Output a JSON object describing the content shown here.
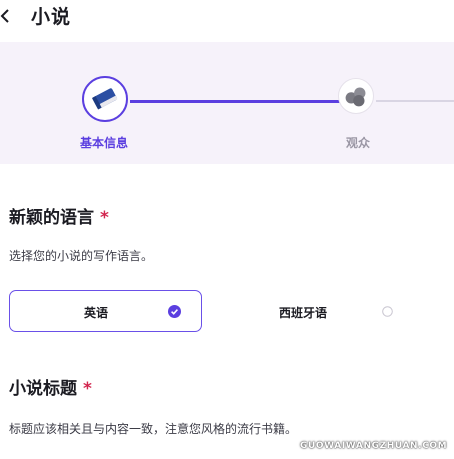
{
  "header": {
    "title": "小说"
  },
  "stepper": {
    "steps": [
      {
        "label": "基本信息",
        "icon": "book-icon",
        "state": "active"
      },
      {
        "label": "观众",
        "icon": "audience-icon",
        "state": "inactive"
      }
    ],
    "accent": "#5b3fe0"
  },
  "language_section": {
    "title": "新颖的语言",
    "required_mark": "*",
    "description": "选择您的小说的写作语言。",
    "options": [
      {
        "label": "英语",
        "selected": true
      },
      {
        "label": "西班牙语",
        "selected": false
      }
    ]
  },
  "title_section": {
    "title": "小说标题",
    "required_mark": "*",
    "description": "标题应该相关且与内容一致，注意您风格的流行书籍。"
  },
  "watermark": "GUOWAIWANGZHUAN.COM"
}
